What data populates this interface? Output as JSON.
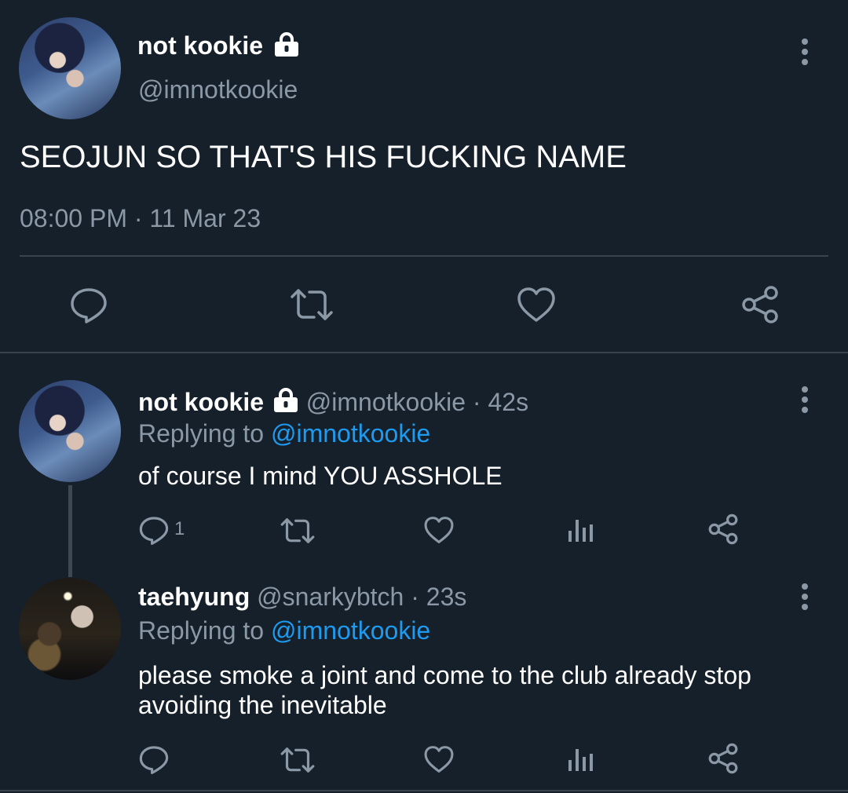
{
  "main_tweet": {
    "display_name": "not kookie",
    "handle": "@imnotkookie",
    "text": "SEOJUN SO THAT'S HIS FUCKING NAME",
    "timestamp": "08:00 PM · 11 Mar 23"
  },
  "replies": [
    {
      "display_name": "not kookie",
      "handle": "@imnotkookie",
      "time": "· 42s",
      "replying_prefix": "Replying to",
      "replying_to": "@imnotkookie",
      "text": "of course I mind YOU ASSHOLE",
      "reply_count": "1"
    },
    {
      "display_name": "taehyung",
      "handle": "@snarkybtch",
      "time": "· 23s",
      "replying_prefix": "Replying to",
      "replying_to": "@imnotkookie",
      "text_line1": "please smoke a joint and come to the club already stop",
      "text_line2": "avoiding the inevitable"
    }
  ],
  "icons": {
    "reply": "reply-icon",
    "retweet": "retweet-icon",
    "like": "heart-icon",
    "share": "share-icon",
    "analytics": "analytics-icon",
    "more": "more-vertical-icon",
    "lock": "lock-icon"
  },
  "colors": {
    "background": "#16202b",
    "text": "#ffffff",
    "muted": "#8b98a5",
    "link": "#1d9bf0",
    "divider": "#38444d"
  }
}
